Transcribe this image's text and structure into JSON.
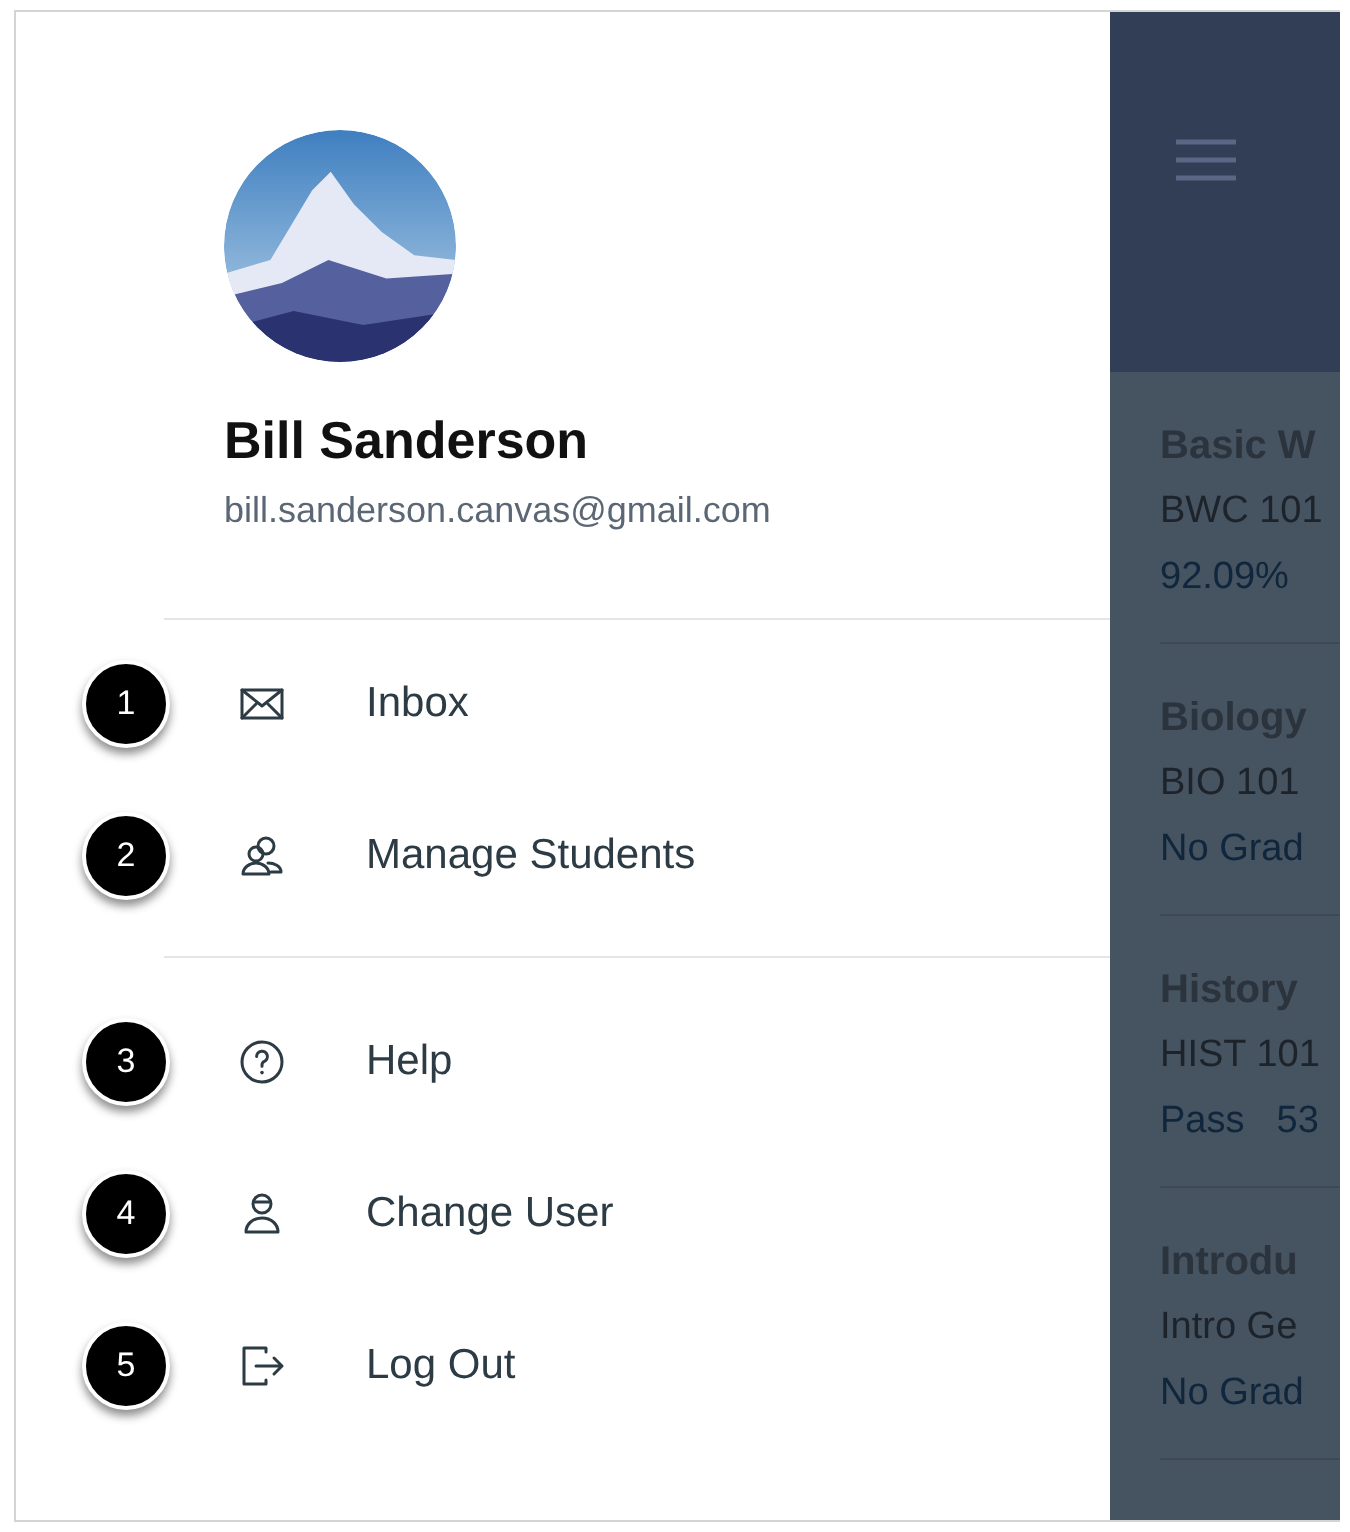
{
  "profile": {
    "name": "Bill Sanderson",
    "email": "bill.sanderson.canvas@gmail.com"
  },
  "menu_groups": [
    [
      {
        "callout": "1",
        "kind": "mail",
        "label": "Inbox"
      },
      {
        "callout": "2",
        "kind": "people",
        "label": "Manage Students"
      }
    ],
    [
      {
        "callout": "3",
        "kind": "help",
        "label": "Help"
      },
      {
        "callout": "4",
        "kind": "user",
        "label": "Change User"
      },
      {
        "callout": "5",
        "kind": "logout",
        "label": "Log Out"
      }
    ]
  ],
  "courses": [
    {
      "title": "Basic W",
      "code": "BWC 101",
      "grade": [
        "92.09%"
      ]
    },
    {
      "title": "Biology",
      "code": "BIO 101",
      "grade": [
        "No Grad"
      ]
    },
    {
      "title": "History",
      "code": "HIST 101",
      "grade": [
        "Pass",
        "53"
      ]
    },
    {
      "title": "Introdu",
      "code": "Intro Ge",
      "grade": [
        "No Grad"
      ]
    }
  ]
}
